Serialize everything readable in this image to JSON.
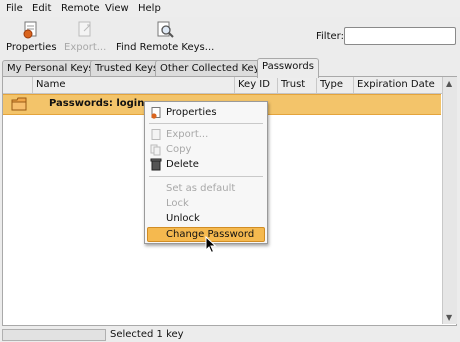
{
  "menubar": [
    "File",
    "Edit",
    "Remote",
    "View",
    "Help"
  ],
  "toolbar": {
    "properties": "Properties",
    "export": "Export...",
    "find_remote_keys": "Find Remote Keys...",
    "filter_label": "Filter:",
    "filter_value": ""
  },
  "tabs": [
    "My Personal Keys",
    "Trusted Keys",
    "Other Collected Keys",
    "Passwords"
  ],
  "table": {
    "columns": [
      "Name",
      "Key ID",
      "Trust",
      "Type",
      "Expiration Date"
    ],
    "rows": [
      {
        "name": "Passwords: login",
        "key_id": "",
        "trust": "",
        "type": "",
        "expiration": ""
      }
    ]
  },
  "context_menu": [
    {
      "label": "Properties",
      "enabled": true,
      "icon": "properties-icon"
    },
    {
      "label": "Export...",
      "enabled": false,
      "icon": "export-icon"
    },
    {
      "label": "Copy",
      "enabled": false,
      "icon": "copy-icon"
    },
    {
      "label": "Delete",
      "enabled": true,
      "icon": "trash-icon"
    },
    {
      "label": "Set as default",
      "enabled": false
    },
    {
      "label": "Lock",
      "enabled": false
    },
    {
      "label": "Unlock",
      "enabled": true
    },
    {
      "label": "Change Password",
      "enabled": true,
      "highlighted": true
    }
  ],
  "status": {
    "text": "Selected 1 key"
  },
  "colors": {
    "selection": "#f3c46a",
    "menu_highlight": "#f5b94f"
  }
}
